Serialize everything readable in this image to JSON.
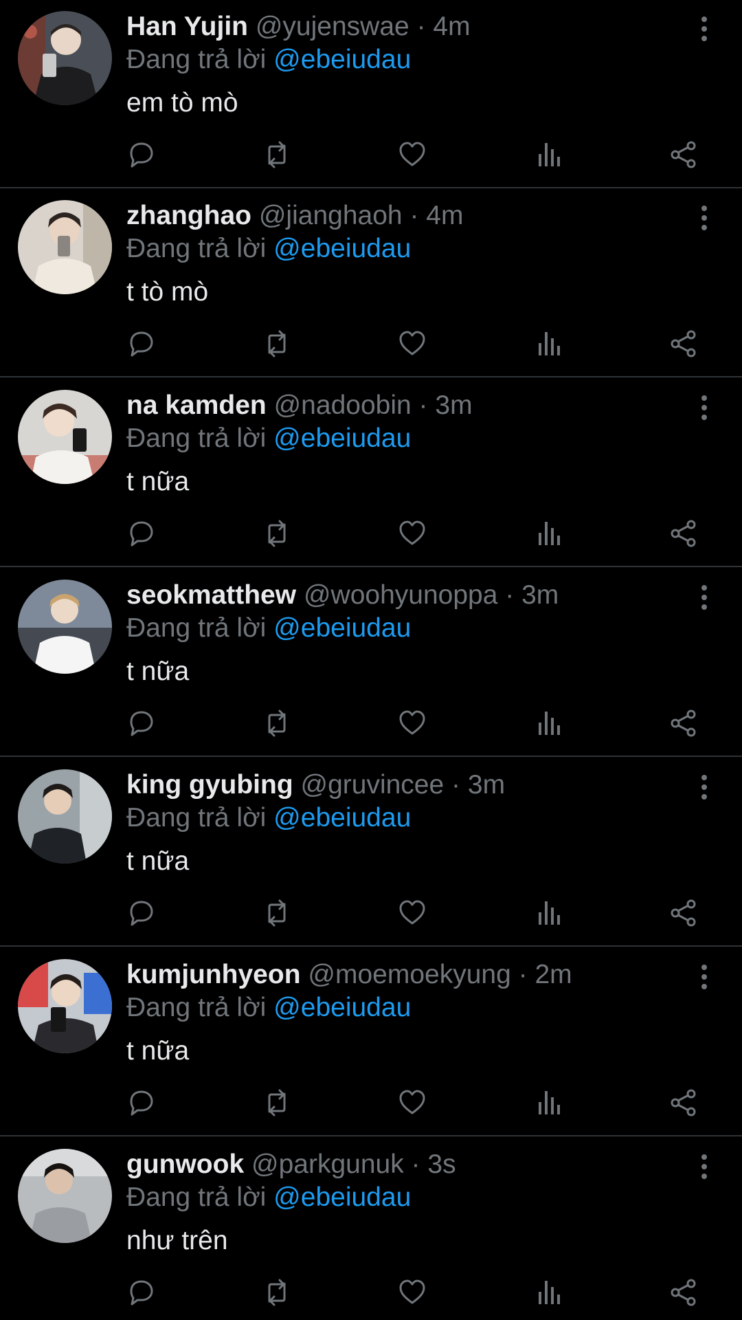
{
  "colors": {
    "background": "#000000",
    "primary_text": "#e7e9ea",
    "secondary_text": "#71767b",
    "link": "#1d9bf0",
    "divider": "#2f3336"
  },
  "icons": {
    "reply": "reply-icon",
    "retweet": "retweet-icon",
    "like": "heart-icon",
    "views": "views-chart-icon",
    "share": "share-icon",
    "more": "more-vertical-icon"
  },
  "tweets": [
    {
      "name": "Han Yujin",
      "handle": "@yujenswae",
      "separator": "·",
      "time": "4m",
      "replying_prefix": "Đang trả lời",
      "replying_to": "@ebeiudau",
      "text": "em tò mò"
    },
    {
      "name": "zhanghao",
      "handle": "@jianghaoh",
      "separator": "·",
      "time": "4m",
      "replying_prefix": "Đang trả lời",
      "replying_to": "@ebeiudau",
      "text": "t tò mò"
    },
    {
      "name": "na kamden",
      "handle": "@nadoobin",
      "separator": "·",
      "time": "3m",
      "replying_prefix": "Đang trả lời",
      "replying_to": "@ebeiudau",
      "text": "t nữa"
    },
    {
      "name": "seokmatthew",
      "handle": "@woohyunoppa",
      "separator": "·",
      "time": "3m",
      "replying_prefix": "Đang trả lời",
      "replying_to": "@ebeiudau",
      "text": "t nữa"
    },
    {
      "name": "king gyubing",
      "handle": "@gruvincee",
      "separator": "·",
      "time": "3m",
      "replying_prefix": "Đang trả lời",
      "replying_to": "@ebeiudau",
      "text": "t nữa"
    },
    {
      "name": "kumjunhyeon",
      "handle": "@moemoekyung",
      "separator": "·",
      "time": "2m",
      "replying_prefix": "Đang trả lời",
      "replying_to": "@ebeiudau",
      "text": "t nữa"
    },
    {
      "name": "gunwook",
      "handle": "@parkgunuk",
      "separator": "·",
      "time": "3s",
      "replying_prefix": "Đang trả lời",
      "replying_to": "@ebeiudau",
      "text": "như trên"
    }
  ]
}
